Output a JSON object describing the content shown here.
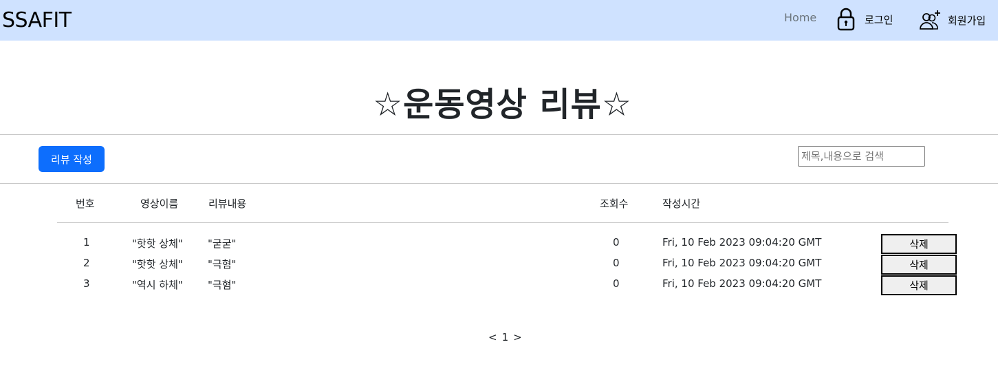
{
  "nav": {
    "brand": "SSAFIT",
    "home": "Home",
    "login": "로그인",
    "signup": "회원가입",
    "icons": {
      "login": "lock-icon",
      "signup": "add-user-icon"
    }
  },
  "page": {
    "title": "☆운동영상 리뷰☆"
  },
  "toolbar": {
    "write_label": "리뷰 작성",
    "search_placeholder": "제목,내용으로 검색"
  },
  "table": {
    "headers": [
      "번호",
      "영상이름",
      "리뷰내용",
      "조회수",
      "작성시간"
    ],
    "rows": [
      {
        "no": "1",
        "video": "\"핫핫 상체\"",
        "content": "\"굳굳\"",
        "views": "0",
        "time": "Fri, 10 Feb 2023 09:04:20 GMT",
        "delete": "삭제"
      },
      {
        "no": "2",
        "video": "\"핫핫 상체\"",
        "content": "\"극혐\"",
        "views": "0",
        "time": "Fri, 10 Feb 2023 09:04:20 GMT",
        "delete": "삭제"
      },
      {
        "no": "3",
        "video": "\"역시 하체\"",
        "content": "\"극혐\"",
        "views": "0",
        "time": "Fri, 10 Feb 2023 09:04:20 GMT",
        "delete": "삭제"
      }
    ]
  },
  "pagination": {
    "prev": "<",
    "page": "1",
    "next": ">"
  },
  "colors": {
    "navbar_bg": "#cfe2ff",
    "primary": "#0d6efd",
    "muted": "#6c757d"
  }
}
